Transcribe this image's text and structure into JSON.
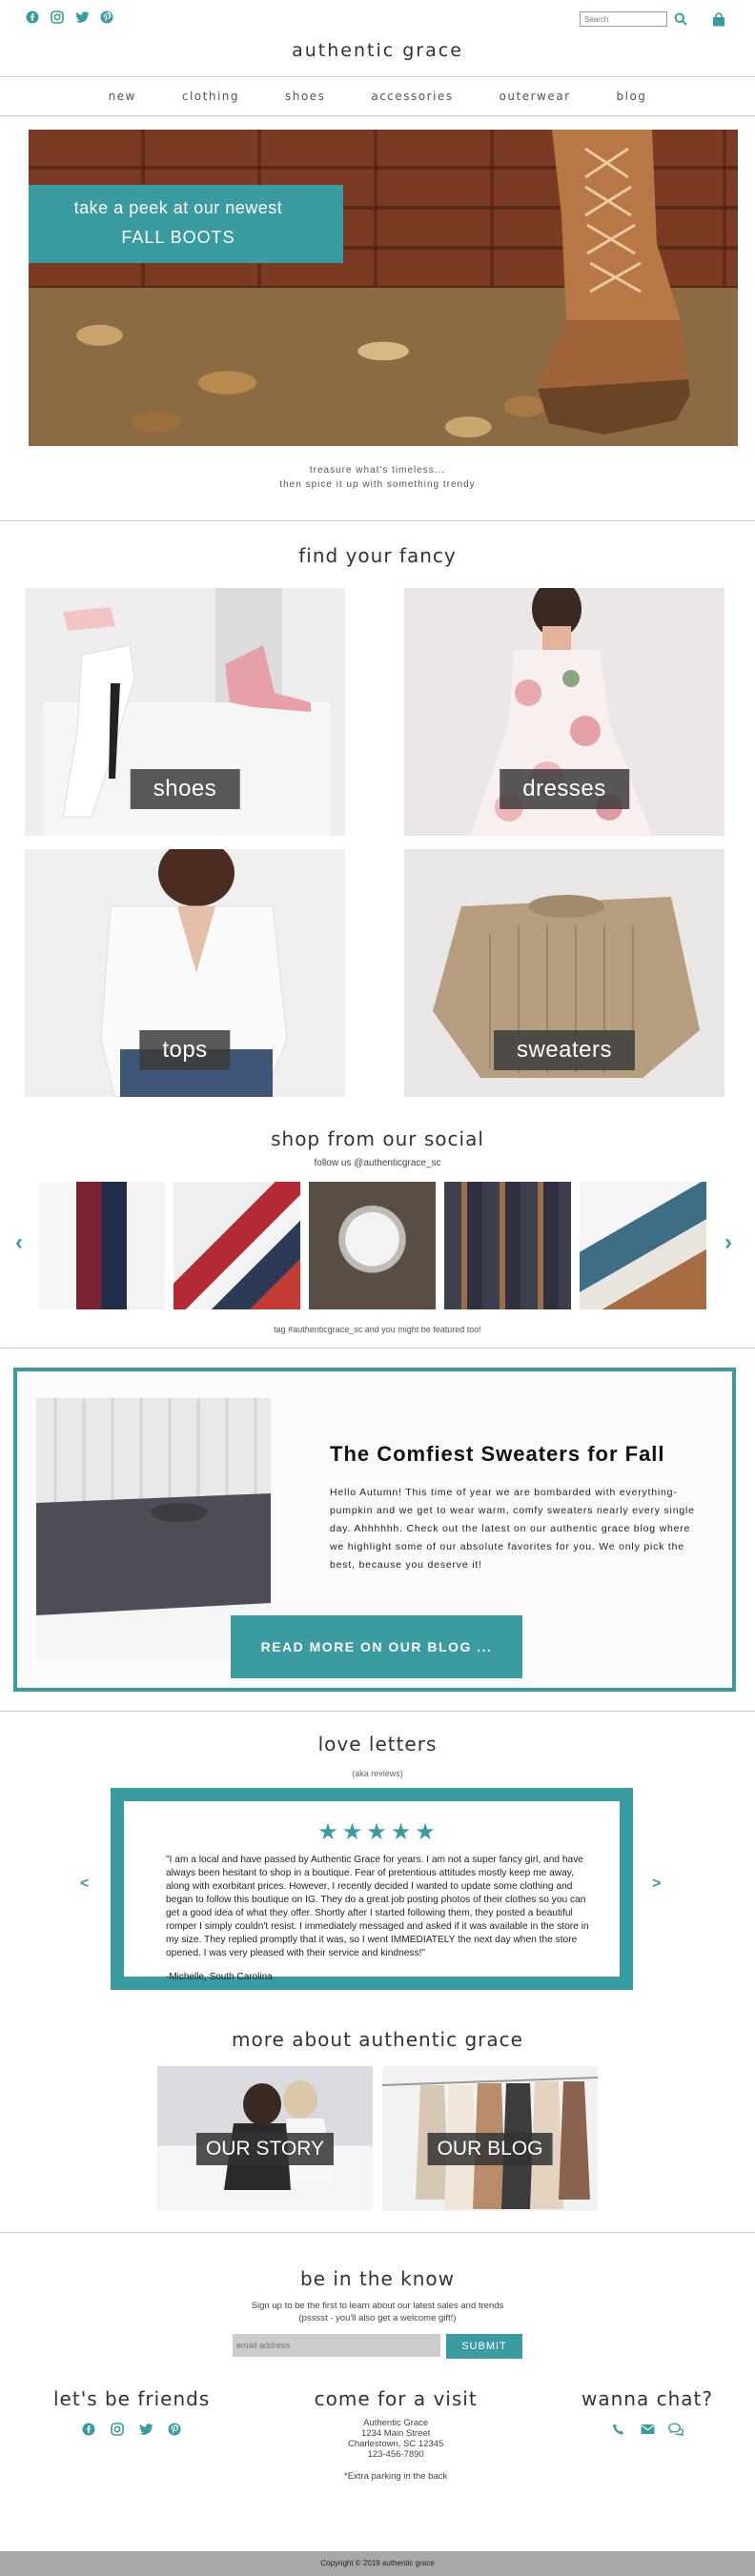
{
  "header": {
    "social_icons": [
      "facebook-icon",
      "instagram-icon",
      "twitter-icon",
      "pinterest-icon"
    ],
    "search_placeholder": "Search",
    "brand": "authentic grace"
  },
  "nav": {
    "items": [
      "new",
      "clothing",
      "shoes",
      "accessories",
      "outerwear",
      "blog"
    ]
  },
  "hero": {
    "line1": "take a peek at our newest",
    "line2": "FALL BOOTS",
    "tagline1": "treasure what's timeless...",
    "tagline2": "then spice it up with something trendy"
  },
  "fancy": {
    "title": "find your fancy",
    "cards": [
      "shoes",
      "dresses",
      "tops",
      "sweaters"
    ]
  },
  "social": {
    "title": "shop from our social",
    "follow": "follow us @authenticgrace_sc",
    "tag_note": "tag #authenticgrace_sc and you might be featured too!"
  },
  "blog": {
    "title": "The Comfiest Sweaters for Fall",
    "text": "Hello Autumn!  This time of year we are bombarded with everything-pumpkin and we get to wear warm, comfy sweaters nearly every single day.  Ahhhhhh.  Check out the latest on our authentic grace blog where we highlight some of our absolute favorites for you.  We only pick the best, because you deserve it!",
    "button": "READ MORE ON OUR BLOG ..."
  },
  "reviews": {
    "title": "love letters",
    "subtitle": "(aka reviews)",
    "stars": "★★★★★",
    "text": "\"I am a local and have passed by Authentic Grace for years.  I am not a super fancy girl, and have always been hesitant to shop in a boutique. Fear of pretentious attitudes mostly keep me away, along with exorbitant prices. However, I recently decided I wanted to update some clothing and began to follow this boutique on IG. They do a great job posting photos of their clothes so you can get a good idea of what they offer. Shortly after I started following them, they posted a beautiful romper I simply couldn't resist. I immediately messaged and asked if it was available in the store in my size. They replied promptly that it was, so I went IMMEDIATELY the next day when the store opened.  I was very pleased with their service and kindness!\"",
    "signature": "-Michelle, South Carolina",
    "prev": "<",
    "next": ">"
  },
  "about": {
    "title": "more about authentic grace",
    "cards": [
      "OUR STORY",
      "OUR BLOG"
    ]
  },
  "newsletter": {
    "title": "be in the know",
    "line1": "Sign up to be the first to learn about our latest sales and trends",
    "line2": "(psssst - you'll also get a welcome gift!)",
    "email_placeholder": "email address",
    "submit": "SUBMIT"
  },
  "footer": {
    "friends_title": "let's be friends",
    "visit_title": "come for a visit",
    "chat_title": "wanna chat?",
    "address": [
      "Authentic Grace",
      "1234 Main Street",
      "Charlestown, SC 12345",
      "123-456-7890"
    ],
    "parking": "*Extra parking in the back",
    "copyright": "Copyright © 2019 authentic grace"
  },
  "colors": {
    "accent": "#3a9ba0"
  }
}
